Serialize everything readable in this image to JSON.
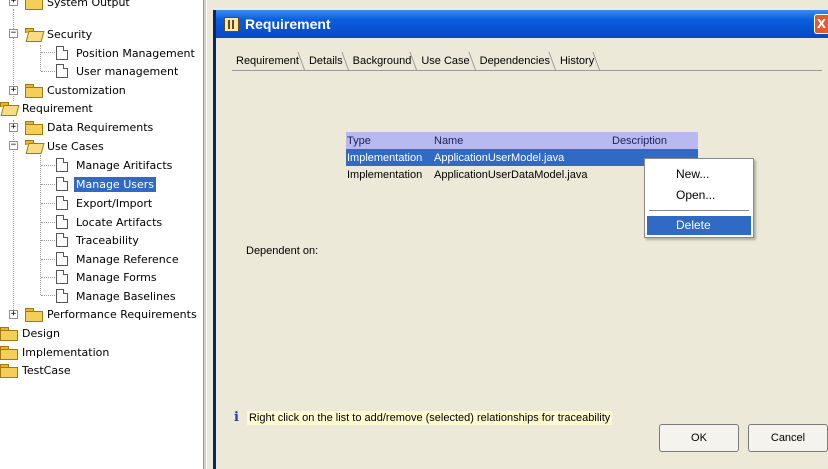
{
  "tree": {
    "items": [
      {
        "label": "System Output"
      },
      {
        "label": "Security"
      },
      {
        "label": "Position Management"
      },
      {
        "label": "User management"
      },
      {
        "label": "Customization"
      },
      {
        "label": "Requirement"
      },
      {
        "label": "Data Requirements"
      },
      {
        "label": "Use Cases"
      },
      {
        "label": "Manage Aritifacts"
      },
      {
        "label": "Manage Users"
      },
      {
        "label": "Export/Import"
      },
      {
        "label": "Locate Artifacts"
      },
      {
        "label": "Traceability"
      },
      {
        "label": "Manage Reference"
      },
      {
        "label": "Manage Forms"
      },
      {
        "label": "Manage Baselines"
      },
      {
        "label": "Performance Requirements"
      },
      {
        "label": "Design"
      },
      {
        "label": "Implementation"
      },
      {
        "label": "TestCase"
      }
    ]
  },
  "dialog": {
    "title": "Requirement",
    "close_label": "X",
    "tabs": [
      {
        "label": "Requirement"
      },
      {
        "label": "Details"
      },
      {
        "label": "Background"
      },
      {
        "label": "Use Case"
      },
      {
        "label": "Dependencies"
      },
      {
        "label": "History"
      }
    ],
    "active_tab": "Dependencies",
    "table": {
      "headers": [
        "Type",
        "Name",
        "Description"
      ],
      "rows": [
        {
          "type": "Implementation",
          "name": "ApplicationUserModel.java",
          "description": ""
        },
        {
          "type": "Implementation",
          "name": "ApplicationUserDataModel.java",
          "description": ""
        }
      ]
    },
    "dependent_on_label": "Dependent on:",
    "context_menu": {
      "items": [
        {
          "label": "New..."
        },
        {
          "label": "Open..."
        },
        {
          "label": "Delete"
        }
      ],
      "highlighted": "Delete"
    },
    "info_icon": "i",
    "info_text": "Right click on the list to add/remove (selected) relationships for traceability",
    "ok_label": "OK",
    "cancel_label": "Cancel"
  },
  "colors": {
    "selection": "#316ac5",
    "titlebar": "#0a5ddc",
    "dialog_bg": "#ece9d8",
    "table_header": "#b9b9f0",
    "info_bg": "#fffbd0"
  },
  "icons": [
    "folder-icon",
    "folder-open-icon",
    "document-icon",
    "expander-icon",
    "app-icon",
    "close-icon",
    "info-icon"
  ]
}
